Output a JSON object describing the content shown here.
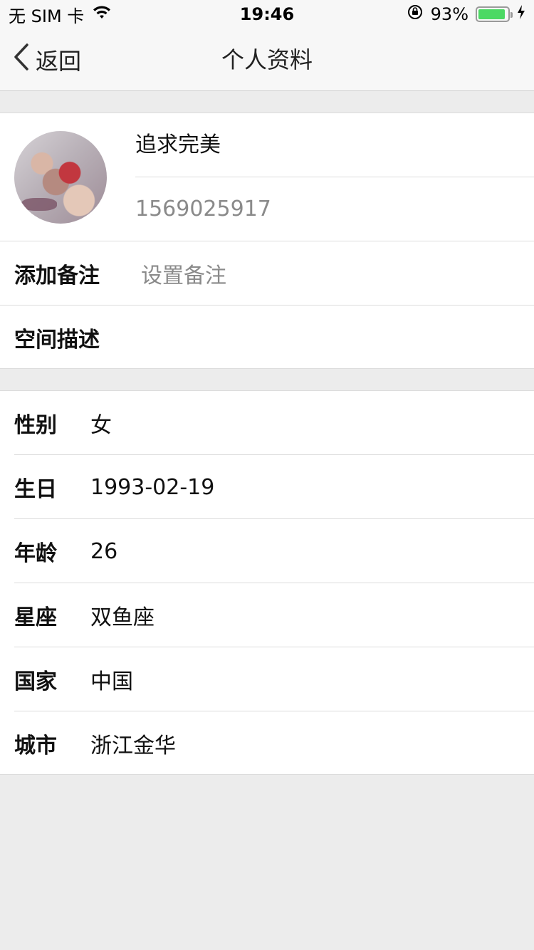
{
  "status_bar": {
    "carrier": "无 SIM 卡",
    "time": "19:46",
    "battery_percent": "93%",
    "battery_level": 0.93,
    "icons": [
      "wifi-icon",
      "rotation-lock-icon",
      "battery-icon",
      "charging-bolt-icon"
    ]
  },
  "nav": {
    "back_label": "返回",
    "title": "个人资料"
  },
  "profile": {
    "nickname": "追求完美",
    "user_id": "1569025917"
  },
  "remark": {
    "label": "添加备注",
    "placeholder": "设置备注"
  },
  "space": {
    "label": "空间描述"
  },
  "details": [
    {
      "label": "性别",
      "value": "女"
    },
    {
      "label": "生日",
      "value": "1993-02-19"
    },
    {
      "label": "年龄",
      "value": "26"
    },
    {
      "label": "星座",
      "value": "双鱼座"
    },
    {
      "label": "国家",
      "value": "中国"
    },
    {
      "label": "城市",
      "value": "浙江金华"
    }
  ],
  "colors": {
    "background": "#ececec",
    "bar": "#f7f7f7",
    "battery_green": "#4cd964",
    "secondary_text": "#8a8a8a"
  }
}
